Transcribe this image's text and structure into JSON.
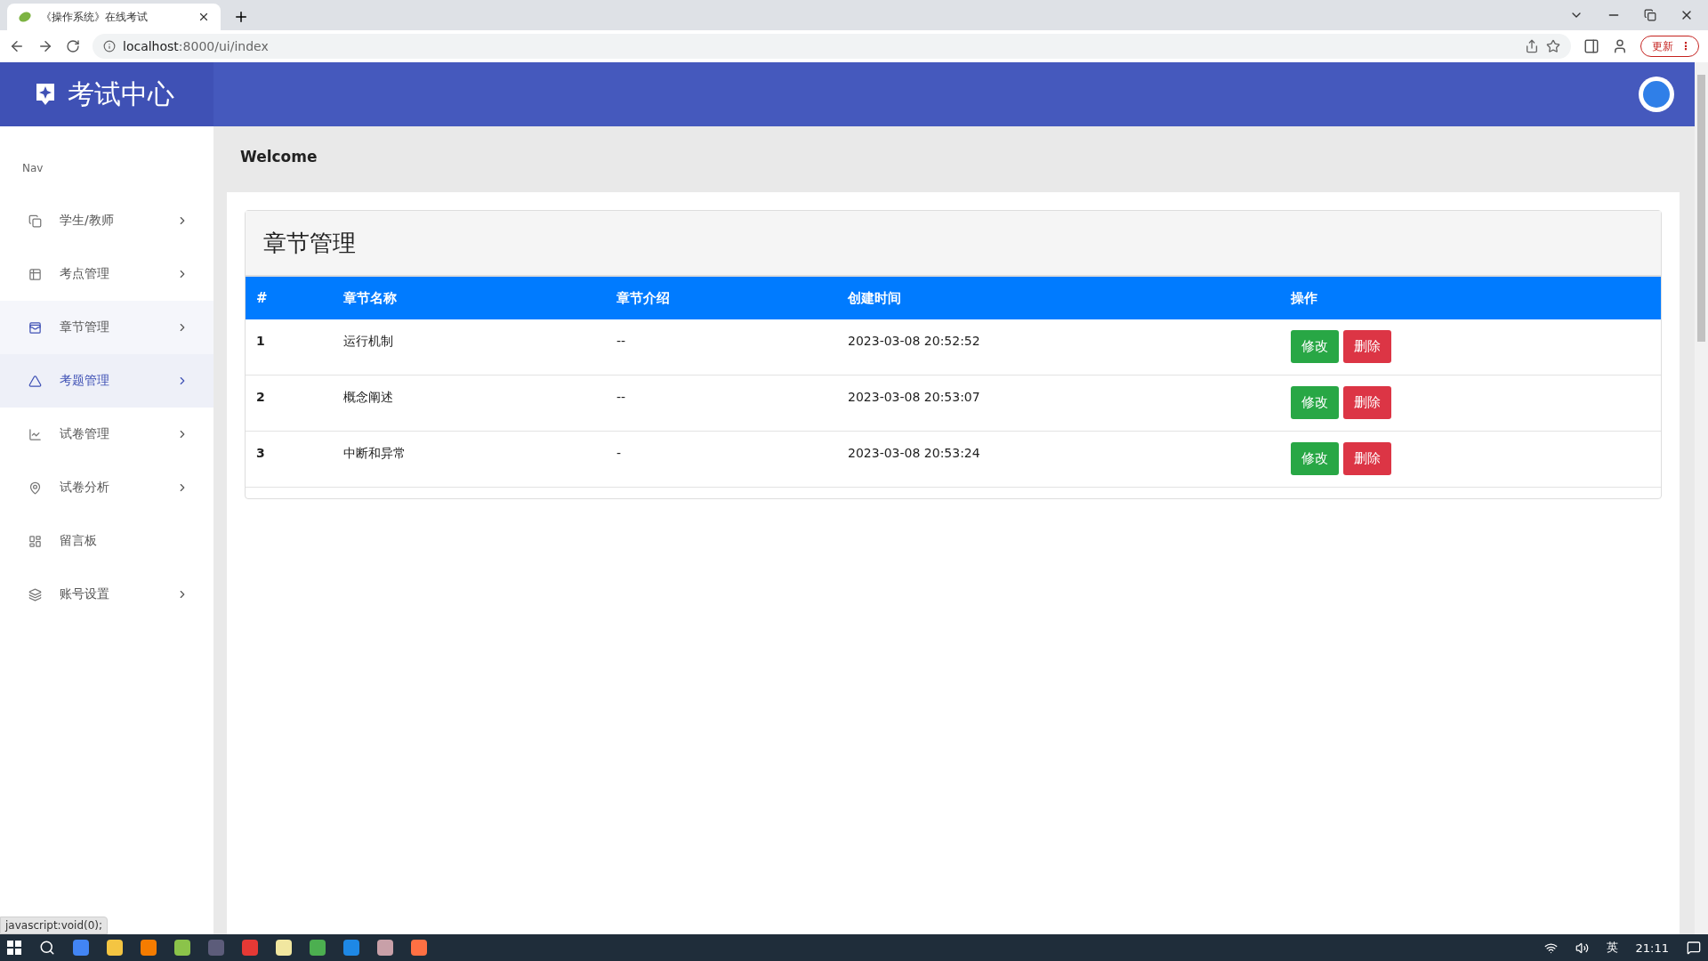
{
  "browser": {
    "tab_title": "《操作系统》在线考试",
    "url_host": "localhost",
    "url_path": ":8000/ui/index",
    "update_button": "更新",
    "update_menu": "⋮",
    "status_text": "javascript:void(0);"
  },
  "header": {
    "title": "考试中心"
  },
  "sidebar": {
    "heading": "Nav",
    "items": [
      {
        "label": "学生/教师",
        "arrow": true,
        "selected": false,
        "hovered": false
      },
      {
        "label": "考点管理",
        "arrow": true,
        "selected": false,
        "hovered": false
      },
      {
        "label": "章节管理",
        "arrow": true,
        "selected": false,
        "hovered": true
      },
      {
        "label": "考题管理",
        "arrow": true,
        "selected": true,
        "hovered": false
      },
      {
        "label": "试卷管理",
        "arrow": true,
        "selected": false,
        "hovered": false
      },
      {
        "label": "试卷分析",
        "arrow": true,
        "selected": false,
        "hovered": false
      },
      {
        "label": "留言板",
        "arrow": false,
        "selected": false,
        "hovered": false
      },
      {
        "label": "账号设置",
        "arrow": true,
        "selected": false,
        "hovered": false
      }
    ]
  },
  "breadcrumb": "Welcome",
  "card": {
    "title": "章节管理",
    "table": {
      "columns": [
        "#",
        "章节名称",
        "章节介绍",
        "创建时间",
        "操作"
      ],
      "rows": [
        {
          "index": "1",
          "name": "运行机制",
          "intro": "--",
          "created": "2023-03-08 20:52:52",
          "actions": [
            "修改",
            "删除"
          ]
        },
        {
          "index": "2",
          "name": "概念阐述",
          "intro": "--",
          "created": "2023-03-08 20:53:07",
          "actions": [
            "修改",
            "删除"
          ]
        },
        {
          "index": "3",
          "name": "中断和异常",
          "intro": "-",
          "created": "2023-03-08 20:53:24",
          "actions": [
            "修改",
            "删除"
          ]
        }
      ]
    }
  },
  "taskbar": {
    "ime": "英",
    "time": "21:11"
  }
}
